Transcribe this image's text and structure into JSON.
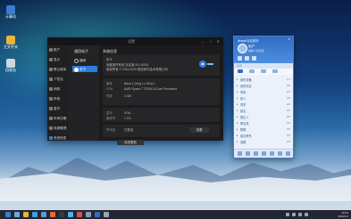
{
  "desktop": {
    "icons": [
      {
        "label": "计算机",
        "color": "#3a7bd5",
        "icon": "computer-icon"
      },
      {
        "label": "主文件夹",
        "color": "#e6b63a",
        "icon": "folder-icon"
      },
      {
        "label": "回收站",
        "color": "#cfd6df",
        "icon": "trash-icon"
      }
    ]
  },
  "settings_window": {
    "title": "设置",
    "sidebar": [
      {
        "label": "账户",
        "icon": "account-icon"
      },
      {
        "label": "显示",
        "icon": "display-icon"
      },
      {
        "label": "默认程序",
        "icon": "default-apps-icon"
      },
      {
        "label": "个性化",
        "icon": "personalization-icon"
      },
      {
        "label": "网络",
        "icon": "network-icon"
      },
      {
        "label": "声音",
        "icon": "sound-icon"
      },
      {
        "label": "蓝牙",
        "icon": "bluetooth-icon"
      },
      {
        "label": "时间日期",
        "icon": "datetime-icon"
      },
      {
        "label": "电源管理",
        "icon": "power-icon"
      },
      {
        "label": "系统信息",
        "icon": "system-info-icon"
      }
    ],
    "middle": {
      "header": "通用电子",
      "options": [
        {
          "label": "通用",
          "selected": false
        },
        {
          "label": "关于",
          "selected": true
        }
      ]
    },
    "content": {
      "header": "系统信息",
      "about_label": "版本",
      "about_text_1": "深度操作系统 社区版 20 (1003)",
      "about_text_2": "版权所有 © 2011-2020 统信软件技术有限公司",
      "rows": [
        {
          "key": "版本",
          "value": "Base 1 (Ling Lu Shu) 1"
        },
        {
          "key": "CPU",
          "value": "AMD Ryzen 7 3700X 8-Core Processor"
        },
        {
          "key": "内存",
          "value": "4 GB"
        },
        {
          "key": "显卡",
          "value": "VGA"
        },
        {
          "key": "版本号",
          "value": "1.0.0"
        },
        {
          "key": "许可证",
          "value": "已激活"
        }
      ],
      "button_license": "查看",
      "button_update": "检查更新"
    }
  },
  "side_panel": {
    "title": "deepin社区助手",
    "username": "用户",
    "signature": "编辑个性签名",
    "search_placeholder": "搜索",
    "groups": [
      {
        "label": "我的设备",
        "count": "1/1"
      },
      {
        "label": "我的好友",
        "count": "0/0"
      },
      {
        "label": "同事",
        "count": "0/0"
      },
      {
        "label": "家人",
        "count": "0/0"
      },
      {
        "label": "同学",
        "count": "0/0"
      },
      {
        "label": "朋友",
        "count": "0/0"
      },
      {
        "label": "陌生人",
        "count": "0/0"
      },
      {
        "label": "黑名单",
        "count": "0/0"
      },
      {
        "label": "群聊",
        "count": "0/0"
      },
      {
        "label": "最近联系",
        "count": "0/0"
      },
      {
        "label": "收藏",
        "count": "0/0"
      }
    ]
  },
  "taskbar": {
    "items": [
      {
        "icon": "launcher-icon",
        "color": "#3a7bd5"
      },
      {
        "icon": "multitask-icon",
        "color": "#6fa8dc"
      },
      {
        "icon": "file-manager-icon",
        "color": "#e6b63a"
      },
      {
        "icon": "browser-icon",
        "color": "#3aa0e8"
      },
      {
        "icon": "mail-icon",
        "color": "#5b9bd5"
      },
      {
        "icon": "music-icon",
        "color": "#e8663a"
      },
      {
        "icon": "terminal-icon",
        "color": "#333a44"
      },
      {
        "icon": "store-icon",
        "color": "#4fb0f0"
      },
      {
        "icon": "video-icon",
        "color": "#d84f4f"
      },
      {
        "icon": "settings-icon",
        "color": "#8a9bb4"
      },
      {
        "icon": "chat-icon",
        "color": "#2f6cc0"
      },
      {
        "icon": "trash-icon",
        "color": "#9aa4b4"
      }
    ],
    "time": "15:53",
    "date": "2024/1/1"
  }
}
